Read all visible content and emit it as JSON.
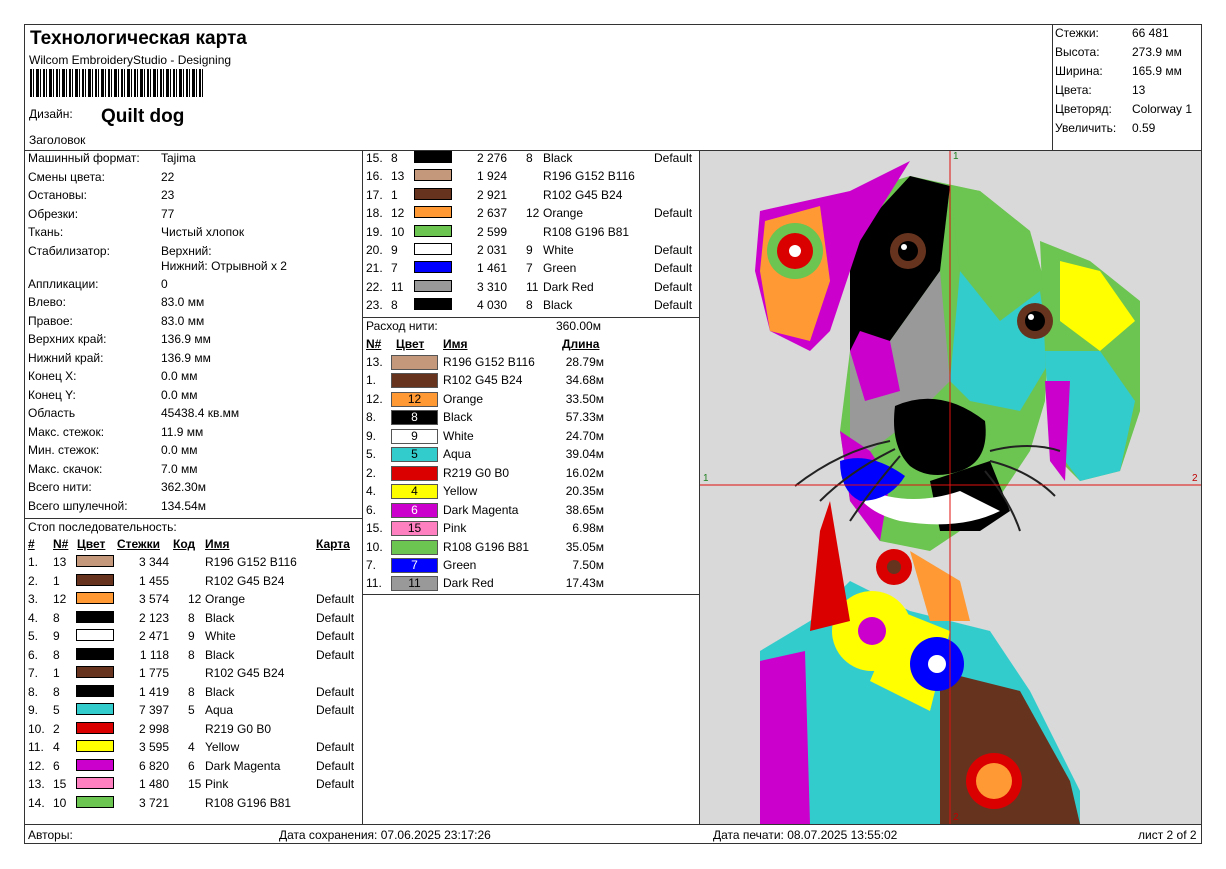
{
  "header": {
    "title": "Технологическая карта",
    "software": "Wilcom EmbroideryStudio - Designing",
    "design_label": "Дизайн:",
    "design_name": "Quilt dog",
    "header_label": "Заголовок"
  },
  "summary": [
    {
      "k": "Стежки:",
      "v": "66 481"
    },
    {
      "k": "Высота:",
      "v": "273.9 мм"
    },
    {
      "k": "Ширина:",
      "v": "165.9 мм"
    },
    {
      "k": "Цвета:",
      "v": "13"
    },
    {
      "k": "Цветоряд:",
      "v": "Colorway 1"
    },
    {
      "k": "Увеличить:",
      "v": "0.59"
    }
  ],
  "info": [
    {
      "k": "Машинный формат:",
      "v": "Tajima"
    },
    {
      "k": "Смены цвета:",
      "v": "22"
    },
    {
      "k": "Остановы:",
      "v": "23"
    },
    {
      "k": "Обрезки:",
      "v": "77"
    },
    {
      "k": "Ткань:",
      "v": "Чистый хлопок"
    },
    {
      "k": "Стабилизатор:",
      "v": "Верхний:",
      "v2": "Нижний: Отрывной x 2"
    },
    {
      "k": "Аппликации:",
      "v": "0"
    },
    {
      "k": "Влево:",
      "v": "83.0 мм"
    },
    {
      "k": "Правое:",
      "v": "83.0 мм"
    },
    {
      "k": "Верхних край:",
      "v": "136.9 мм"
    },
    {
      "k": "Нижний край:",
      "v": "136.9 мм"
    },
    {
      "k": "Конец X:",
      "v": "0.0 мм"
    },
    {
      "k": "Конец Y:",
      "v": "0.0 мм"
    },
    {
      "k": "Область",
      "v": "45438.4 кв.мм"
    },
    {
      "k": "Макс. стежок:",
      "v": "11.9 мм"
    },
    {
      "k": "Мин. стежок:",
      "v": "0.0 мм"
    },
    {
      "k": "Макс. скачок:",
      "v": "7.0 мм"
    },
    {
      "k": "Всего нити:",
      "v": "362.30м"
    },
    {
      "k": "Всего шпулечной:",
      "v": "134.54м"
    }
  ],
  "stops": {
    "title": "Стоп последовательность:",
    "headers": {
      "num": "#",
      "n": "N#",
      "color": "Цвет",
      "stitches": "Стежки",
      "code": "Код",
      "name": "Имя",
      "chart": "Карта"
    },
    "rows": [
      {
        "num": "1.",
        "n": "13",
        "color": "#c4987a",
        "stitches": "3 344",
        "code": "",
        "name": "R196 G152 B116",
        "chart": ""
      },
      {
        "num": "2.",
        "n": "1",
        "color": "#66331e",
        "stitches": "1 455",
        "code": "",
        "name": "R102 G45 B24",
        "chart": ""
      },
      {
        "num": "3.",
        "n": "12",
        "color": "#ff9933",
        "stitches": "3 574",
        "code": "12",
        "name": "Orange",
        "chart": "Default"
      },
      {
        "num": "4.",
        "n": "8",
        "color": "#000000",
        "stitches": "2 123",
        "code": "8",
        "name": "Black",
        "chart": "Default"
      },
      {
        "num": "5.",
        "n": "9",
        "color": "#ffffff",
        "stitches": "2 471",
        "code": "9",
        "name": "White",
        "chart": "Default"
      },
      {
        "num": "6.",
        "n": "8",
        "color": "#000000",
        "stitches": "1 118",
        "code": "8",
        "name": "Black",
        "chart": "Default"
      },
      {
        "num": "7.",
        "n": "1",
        "color": "#66331e",
        "stitches": "1 775",
        "code": "",
        "name": "R102 G45 B24",
        "chart": ""
      },
      {
        "num": "8.",
        "n": "8",
        "color": "#000000",
        "stitches": "1 419",
        "code": "8",
        "name": "Black",
        "chart": "Default"
      },
      {
        "num": "9.",
        "n": "5",
        "color": "#33cccc",
        "stitches": "7 397",
        "code": "5",
        "name": "Aqua",
        "chart": "Default"
      },
      {
        "num": "10.",
        "n": "2",
        "color": "#db0000",
        "stitches": "2 998",
        "code": "",
        "name": "R219 G0 B0",
        "chart": ""
      },
      {
        "num": "11.",
        "n": "4",
        "color": "#ffff00",
        "stitches": "3 595",
        "code": "4",
        "name": "Yellow",
        "chart": "Default"
      },
      {
        "num": "12.",
        "n": "6",
        "color": "#cc00cc",
        "stitches": "6 820",
        "code": "6",
        "name": "Dark Magenta",
        "chart": "Default"
      },
      {
        "num": "13.",
        "n": "15",
        "color": "#ff80c0",
        "stitches": "1 480",
        "code": "15",
        "name": "Pink",
        "chart": "Default"
      },
      {
        "num": "14.",
        "n": "10",
        "color": "#6cc451",
        "stitches": "3 721",
        "code": "",
        "name": "R108 G196 B81",
        "chart": ""
      },
      {
        "num": "15.",
        "n": "8",
        "color": "#000000",
        "stitches": "2 276",
        "code": "8",
        "name": "Black",
        "chart": "Default"
      },
      {
        "num": "16.",
        "n": "13",
        "color": "#c4987a",
        "stitches": "1 924",
        "code": "",
        "name": "R196 G152 B116",
        "chart": ""
      },
      {
        "num": "17.",
        "n": "1",
        "color": "#66331e",
        "stitches": "2 921",
        "code": "",
        "name": "R102 G45 B24",
        "chart": ""
      },
      {
        "num": "18.",
        "n": "12",
        "color": "#ff9933",
        "stitches": "2 637",
        "code": "12",
        "name": "Orange",
        "chart": "Default"
      },
      {
        "num": "19.",
        "n": "10",
        "color": "#6cc451",
        "stitches": "2 599",
        "code": "",
        "name": "R108 G196 B81",
        "chart": ""
      },
      {
        "num": "20.",
        "n": "9",
        "color": "#ffffff",
        "stitches": "2 031",
        "code": "9",
        "name": "White",
        "chart": "Default"
      },
      {
        "num": "21.",
        "n": "7",
        "color": "#0000ff",
        "stitches": "1 461",
        "code": "7",
        "name": "Green",
        "chart": "Default"
      },
      {
        "num": "22.",
        "n": "11",
        "color": "#999999",
        "stitches": "3 310",
        "code": "11",
        "name": "Dark Red",
        "chart": "Default"
      },
      {
        "num": "23.",
        "n": "8",
        "color": "#000000",
        "stitches": "4 030",
        "code": "8",
        "name": "Black",
        "chart": "Default"
      }
    ]
  },
  "usage": {
    "label": "Расход нити:",
    "total": "360.00м",
    "headers": {
      "n": "N#",
      "color": "Цвет",
      "name": "Имя",
      "length": "Длина"
    },
    "rows": [
      {
        "n": "13.",
        "color": "#c4987a",
        "code": "",
        "name": "R196 G152 B116",
        "length": "28.79м",
        "fg": "#000"
      },
      {
        "n": "1.",
        "color": "#66331e",
        "code": "",
        "name": "R102 G45 B24",
        "length": "34.68м",
        "fg": "#fff"
      },
      {
        "n": "12.",
        "color": "#ff9933",
        "code": "12",
        "name": "Orange",
        "length": "33.50м",
        "fg": "#000"
      },
      {
        "n": "8.",
        "color": "#000000",
        "code": "8",
        "name": "Black",
        "length": "57.33м",
        "fg": "#fff"
      },
      {
        "n": "9.",
        "color": "#ffffff",
        "code": "9",
        "name": "White",
        "length": "24.70м",
        "fg": "#000"
      },
      {
        "n": "5.",
        "color": "#33cccc",
        "code": "5",
        "name": "Aqua",
        "length": "39.04м",
        "fg": "#000"
      },
      {
        "n": "2.",
        "color": "#db0000",
        "code": "",
        "name": "R219 G0 B0",
        "length": "16.02м",
        "fg": "#fff"
      },
      {
        "n": "4.",
        "color": "#ffff00",
        "code": "4",
        "name": "Yellow",
        "length": "20.35м",
        "fg": "#000"
      },
      {
        "n": "6.",
        "color": "#cc00cc",
        "code": "6",
        "name": "Dark Magenta",
        "length": "38.65м",
        "fg": "#fff"
      },
      {
        "n": "15.",
        "color": "#ff80c0",
        "code": "15",
        "name": "Pink",
        "length": "6.98м",
        "fg": "#000"
      },
      {
        "n": "10.",
        "color": "#6cc451",
        "code": "",
        "name": "R108 G196 B81",
        "length": "35.05м",
        "fg": "#000"
      },
      {
        "n": "7.",
        "color": "#0000ff",
        "code": "7",
        "name": "Green",
        "length": "7.50м",
        "fg": "#fff"
      },
      {
        "n": "11.",
        "color": "#999999",
        "code": "11",
        "name": "Dark Red",
        "length": "17.43м",
        "fg": "#000"
      }
    ]
  },
  "preview": {
    "marker_top": "1",
    "marker_bottom": "2",
    "marker_left": "1",
    "marker_right": "2",
    "background": "#d9d9d9"
  },
  "footer": {
    "authors": "Авторы:",
    "saved": "Дата сохранения: 07.06.2025 23:17:26",
    "printed": "Дата печати: 08.07.2025 13:55:02",
    "sheet": "лист 2 of 2"
  }
}
